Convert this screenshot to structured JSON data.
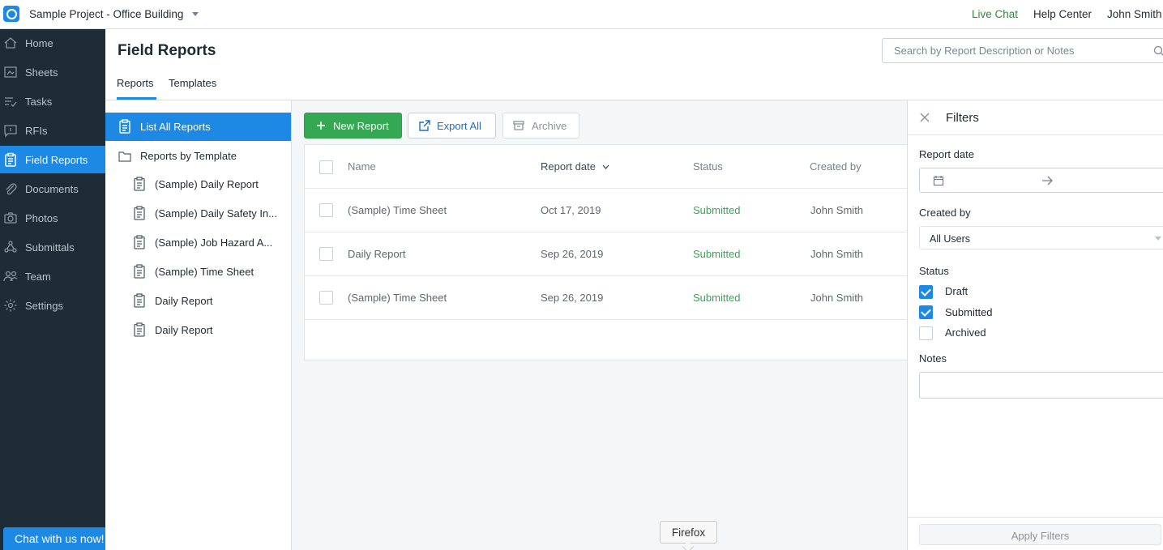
{
  "topbar": {
    "project_name": "Sample Project - Office Building",
    "live_chat": "Live Chat",
    "help_center": "Help Center",
    "user_name": "John Smith"
  },
  "nav": {
    "items": [
      {
        "label": "Home",
        "icon": "home-icon"
      },
      {
        "label": "Sheets",
        "icon": "sheets-icon"
      },
      {
        "label": "Tasks",
        "icon": "tasks-icon"
      },
      {
        "label": "RFIs",
        "icon": "rfis-icon"
      },
      {
        "label": "Field Reports",
        "icon": "clipboard-icon",
        "active": true
      },
      {
        "label": "Documents",
        "icon": "paperclip-icon"
      },
      {
        "label": "Photos",
        "icon": "camera-icon"
      },
      {
        "label": "Submittals",
        "icon": "submittals-icon"
      },
      {
        "label": "Team",
        "icon": "team-icon"
      },
      {
        "label": "Settings",
        "icon": "gear-icon"
      }
    ],
    "chat_button": "Chat with us now!"
  },
  "header": {
    "title": "Field Reports",
    "search_placeholder": "Search by Report Description or Notes",
    "tabs": [
      "Reports",
      "Templates"
    ]
  },
  "templates": {
    "list_all": "List All Reports",
    "by_template": "Reports by Template",
    "items": [
      "(Sample) Daily Report",
      "(Sample) Daily Safety In...",
      "(Sample) Job Hazard A...",
      "(Sample) Time Sheet",
      "Daily Report",
      "Daily Report"
    ]
  },
  "toolbar": {
    "new_report": "New Report",
    "export_all": "Export All",
    "archive": "Archive"
  },
  "table": {
    "columns": [
      "Name",
      "Report date",
      "Status",
      "Created by"
    ],
    "rows": [
      {
        "name": "(Sample) Time Sheet",
        "date": "Oct 17, 2019",
        "status": "Submitted",
        "created_by": "John Smith"
      },
      {
        "name": "Daily Report",
        "date": "Sep 26, 2019",
        "status": "Submitted",
        "created_by": "John Smith"
      },
      {
        "name": "(Sample) Time Sheet",
        "date": "Sep 26, 2019",
        "status": "Submitted",
        "created_by": "John Smith"
      }
    ]
  },
  "filters": {
    "title": "Filters",
    "report_date_label": "Report date",
    "created_by_label": "Created by",
    "created_by_value": "All Users",
    "status_label": "Status",
    "status_options": [
      {
        "label": "Draft",
        "checked": true
      },
      {
        "label": "Submitted",
        "checked": true
      },
      {
        "label": "Archived",
        "checked": false
      }
    ],
    "notes_label": "Notes",
    "apply": "Apply Filters"
  },
  "tooltip": "Firefox",
  "colors": {
    "accent": "#1e88e5",
    "success": "#34a853",
    "nav_bg": "#1d2c36",
    "live_chat": "#2e8b3a"
  }
}
